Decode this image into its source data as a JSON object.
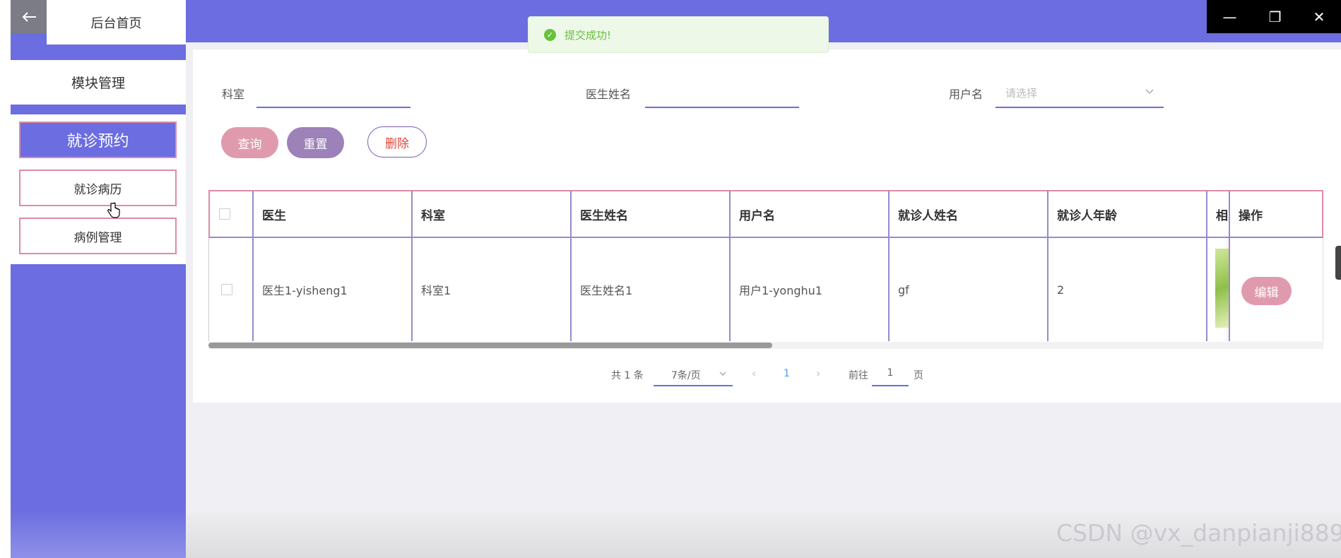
{
  "sidebar": {
    "home_label": "后台首页",
    "module_label": "模块管理",
    "items": [
      {
        "label": "就诊预约",
        "active": true
      },
      {
        "label": "就诊病历",
        "active": false
      },
      {
        "label": "病例管理",
        "active": false
      }
    ]
  },
  "toast": {
    "message": "提交成功!"
  },
  "filters": {
    "department_label": "科室",
    "doctor_name_label": "医生姓名",
    "username_label": "用户名",
    "username_placeholder": "请选择"
  },
  "buttons": {
    "query": "查询",
    "reset": "重置",
    "delete": "删除",
    "edit": "编辑"
  },
  "table": {
    "headers": [
      "医生",
      "科室",
      "医生姓名",
      "用户名",
      "就诊人姓名",
      "就诊人年龄",
      "相",
      "操作"
    ],
    "rows": [
      {
        "doctor": "医生1-yisheng1",
        "department": "科室1",
        "doctor_name": "医生姓名1",
        "username": "用户1-yonghu1",
        "patient_name": "gf",
        "patient_age": "2"
      }
    ]
  },
  "pagination": {
    "total": "共 1 条",
    "page_size": "7条/页",
    "current_page": "1",
    "goto_prefix": "前往",
    "goto_value": "1",
    "goto_suffix": "页"
  },
  "watermark": "CSDN @vx_danpianji889",
  "colors": {
    "primary": "#6b6de0",
    "pink": "#e09aae",
    "purple": "#9c82b8",
    "success": "#67c23a"
  }
}
